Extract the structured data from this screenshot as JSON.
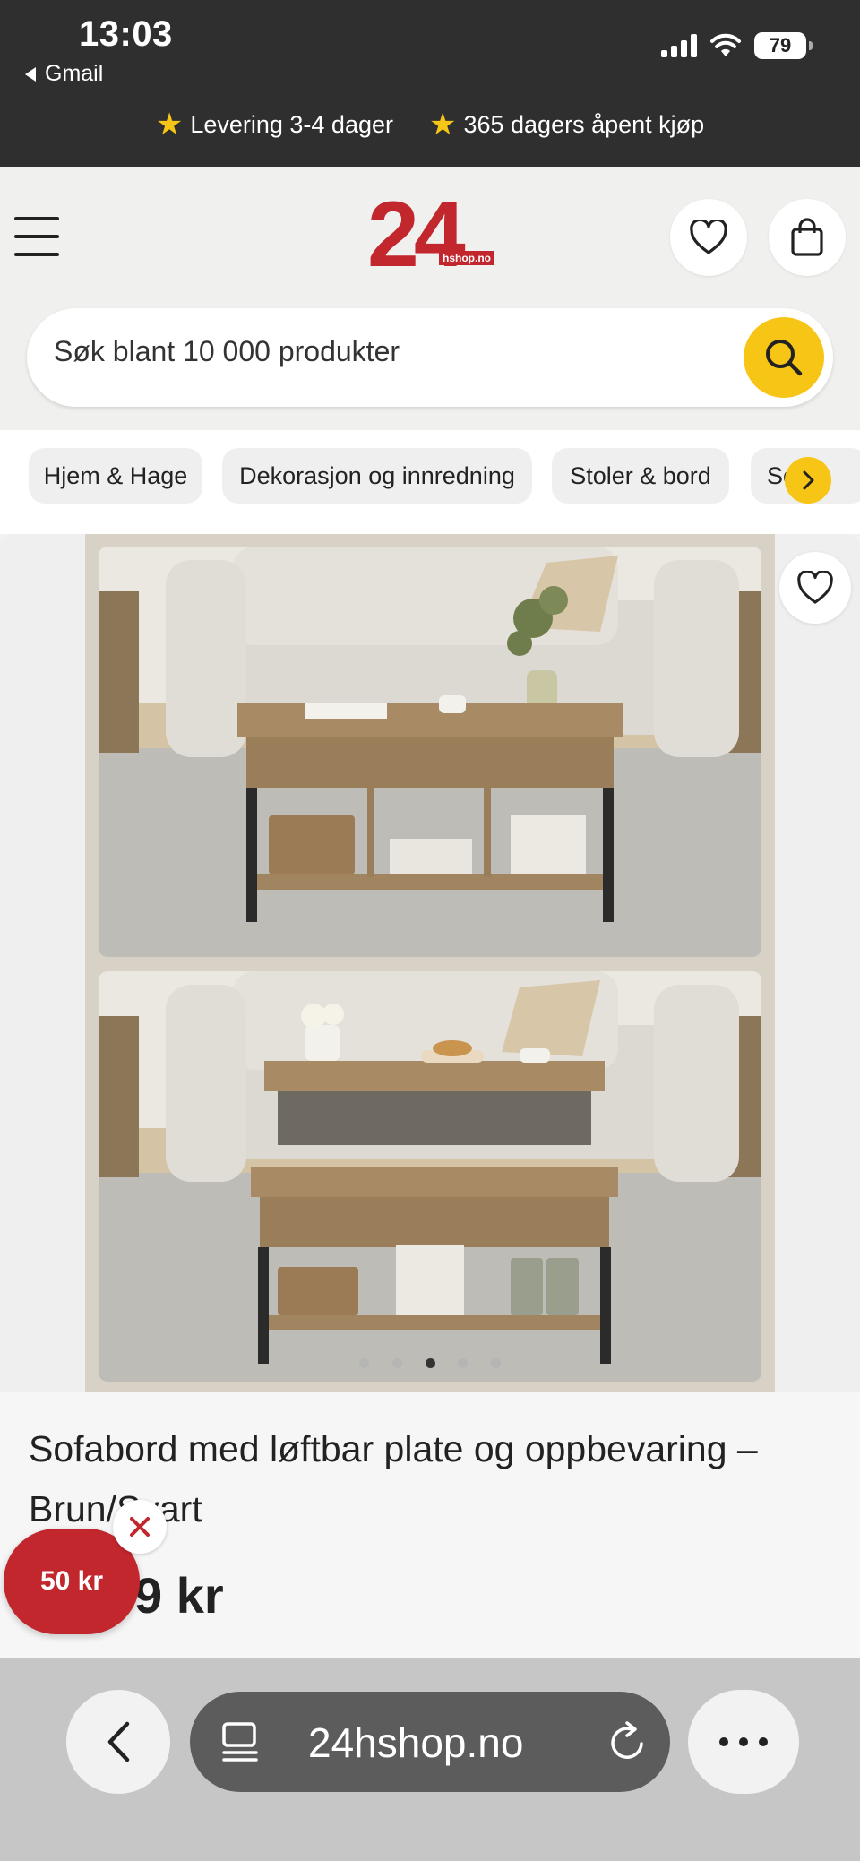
{
  "status_bar": {
    "time": "13:03",
    "back_app": "Gmail",
    "battery": "79"
  },
  "promo": {
    "items": [
      "Levering 3-4 dager",
      "365 dagers åpent kjøp"
    ]
  },
  "header": {
    "logo_number": "24",
    "logo_domain": "hshop.no"
  },
  "search": {
    "placeholder": "Søk blant 10 000 produkter"
  },
  "categories": [
    "Hjem & Hage",
    "Dekorasjon og innredning",
    "Stoler & bord",
    "So"
  ],
  "gallery": {
    "total_images": 5,
    "active_index": 2
  },
  "product": {
    "title": "Sofabord med løftbar plate og oppbevaring – Brun/Svart",
    "price_visible": "9 kr"
  },
  "discount_badge": {
    "label": "50 kr"
  },
  "browser": {
    "url": "24hshop.no"
  },
  "colors": {
    "brand_red": "#c1272d",
    "accent_yellow": "#f7c515",
    "status_bar_bg": "#2f2f2f"
  }
}
